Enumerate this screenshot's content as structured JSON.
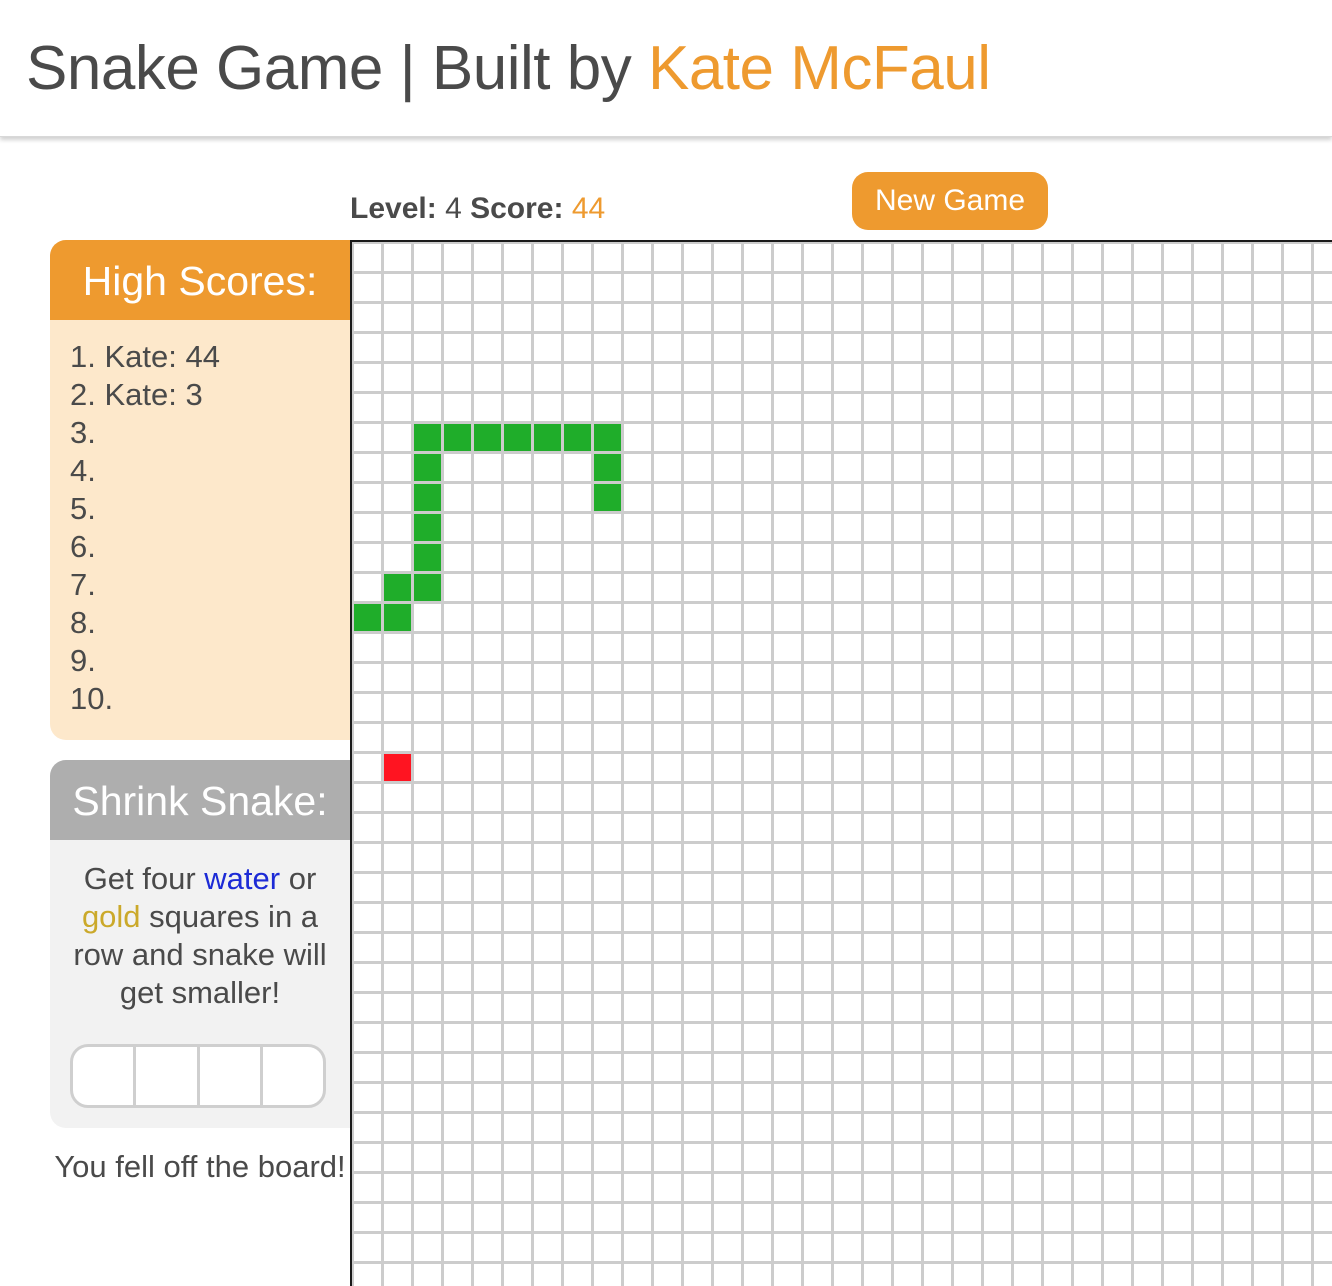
{
  "header": {
    "title_prefix": "Snake Game | Built by ",
    "author": "Kate McFaul"
  },
  "stats": {
    "level_label": "Level:",
    "level_value": "4",
    "score_label": "Score:",
    "score_value": "44"
  },
  "new_game_label": "New Game",
  "high_scores": {
    "title": "High Scores:",
    "entries": [
      "1. Kate: 44",
      "2. Kate: 3",
      "3.",
      "4.",
      "5.",
      "6.",
      "7.",
      "8.",
      "9.",
      "10."
    ]
  },
  "shrink": {
    "title": "Shrink Snake:",
    "text_1": "Get four ",
    "water": "water",
    "text_2": " or ",
    "gold": "gold",
    "text_3": " squares in a row and snake will get smaller!",
    "tracker_slots": 4
  },
  "message": "You fell off the board!",
  "board": {
    "snake_color": "#1fad2a",
    "food_color": "#ff1421",
    "snake_cells": [
      [
        0,
        12
      ],
      [
        1,
        12
      ],
      [
        1,
        11
      ],
      [
        2,
        11
      ],
      [
        2,
        10
      ],
      [
        2,
        9
      ],
      [
        2,
        8
      ],
      [
        2,
        7
      ],
      [
        2,
        6
      ],
      [
        3,
        6
      ],
      [
        4,
        6
      ],
      [
        5,
        6
      ],
      [
        6,
        6
      ],
      [
        7,
        6
      ],
      [
        8,
        6
      ],
      [
        8,
        7
      ],
      [
        8,
        8
      ]
    ],
    "food_cells": [
      [
        1,
        17
      ]
    ]
  },
  "colors": {
    "accent": "#ee9a2f",
    "text": "#4a4a4a",
    "panel_light": "#fde8cb",
    "panel_gray_head": "#aeaeae",
    "grid_line": "#cccccc"
  }
}
